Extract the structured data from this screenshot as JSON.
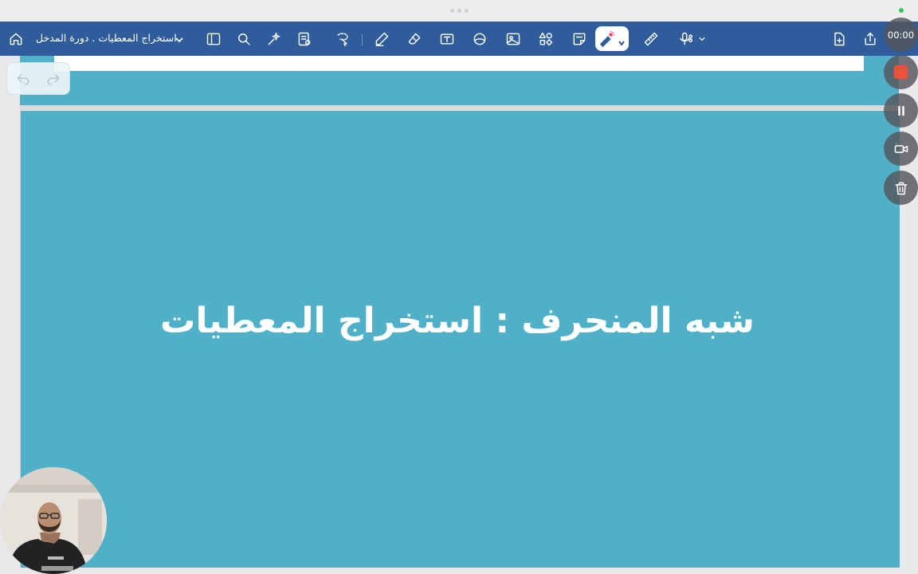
{
  "document": {
    "title": "استخراج المعطيات . دورة المدخل"
  },
  "toolbar": {
    "left_icons": [
      "home-icon"
    ],
    "tools": [
      "sidebar-icon",
      "search-icon",
      "sparkle-wand-icon",
      "document-list-icon",
      "lasso-icon",
      "pen-icon",
      "eraser-icon",
      "text-box-icon",
      "shape-fill-icon",
      "image-icon",
      "shapes-icon",
      "sticky-note-icon",
      "laser-pointer-icon",
      "ruler-icon",
      "microphone-icon"
    ],
    "right_icons": [
      "add-page-icon",
      "share-icon"
    ],
    "active_tool": "laser-pointer-icon",
    "accent_color": "#2f5d9c"
  },
  "slide": {
    "title": "شبه المنحرف  : استخراج المعطيات",
    "background_color": "#4fb0c8",
    "text_color": "#ffffff"
  },
  "recording": {
    "timer": "00:00",
    "controls": [
      "stop-icon",
      "pause-icon",
      "camera-switch-icon",
      "trash-icon"
    ],
    "stop_color": "#f0503a"
  },
  "history": {
    "controls": [
      "undo-icon",
      "redo-icon"
    ]
  }
}
